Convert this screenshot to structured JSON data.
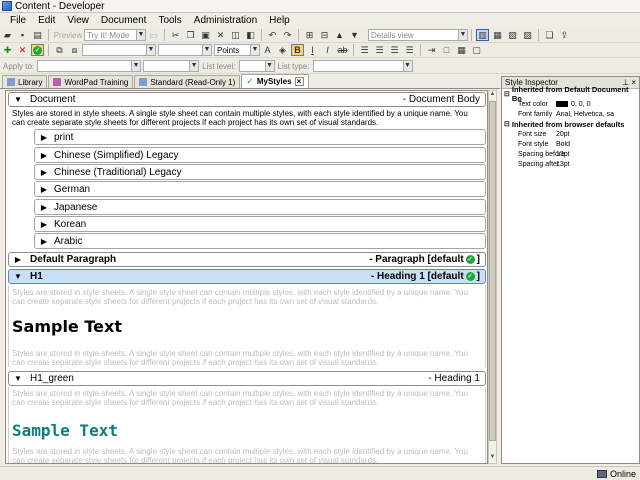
{
  "window": {
    "title": "Content - Developer"
  },
  "menu": [
    "File",
    "Edit",
    "View",
    "Document",
    "Tools",
    "Administration",
    "Help"
  ],
  "toolbar": {
    "preview_label": "Preview",
    "mode_value": "Try It! Mode",
    "view_value": "Details view",
    "units_value": "Points",
    "apply_to_label": "Apply to:",
    "list_level_label": "List level:",
    "list_type_label": "List type:"
  },
  "tabs": [
    {
      "label": "Library",
      "active": false
    },
    {
      "label": "WordPad Training",
      "active": false
    },
    {
      "label": "Standard (Read-Only 1)",
      "active": false
    },
    {
      "label": "MyStyles",
      "active": true
    }
  ],
  "styles": {
    "document": {
      "name": "Document",
      "kind": "- Document Body"
    },
    "description": "Styles are stored in style sheets. A single style sheet can contain multiple styles, with each style identified by a unique name. You can create separate style sheets for different projects if each project has its own set of visual standards.",
    "sub_items": [
      "print",
      "Chinese (Simplified) Legacy",
      "Chinese (Traditional) Legacy",
      "German",
      "Japanese",
      "Korean",
      "Arabic"
    ],
    "default_paragraph": {
      "name": "Default Paragraph",
      "kind": "- Paragraph [default",
      "suffix": "]"
    },
    "h1": {
      "name": "H1",
      "kind": "- Heading 1 [default",
      "suffix": "]"
    },
    "h1_green": {
      "name": "H1_green",
      "kind": "- Heading 1"
    },
    "sample_text": "Sample Text"
  },
  "inspector": {
    "title": "Style Inspector",
    "sections": [
      {
        "heading": "Inherited from Default Document Bo",
        "rows": [
          {
            "key": "Text color",
            "value": "0, 0, 0",
            "swatch": "#000000"
          },
          {
            "key": "Font family",
            "value": "Arial, Helvetica, sa"
          }
        ]
      },
      {
        "heading": "Inherited from browser defaults",
        "rows": [
          {
            "key": "Font size",
            "value": "20pt"
          },
          {
            "key": "Font style",
            "value": "Bold"
          },
          {
            "key": "Spacing before",
            "value": "13pt"
          },
          {
            "key": "Spacing after",
            "value": "13pt"
          }
        ]
      }
    ]
  },
  "status": {
    "connection": "Online"
  },
  "colors": {
    "selected_row": "#c9dff6",
    "green_heading": "#0b7e7e",
    "check": "#1ea83c"
  }
}
